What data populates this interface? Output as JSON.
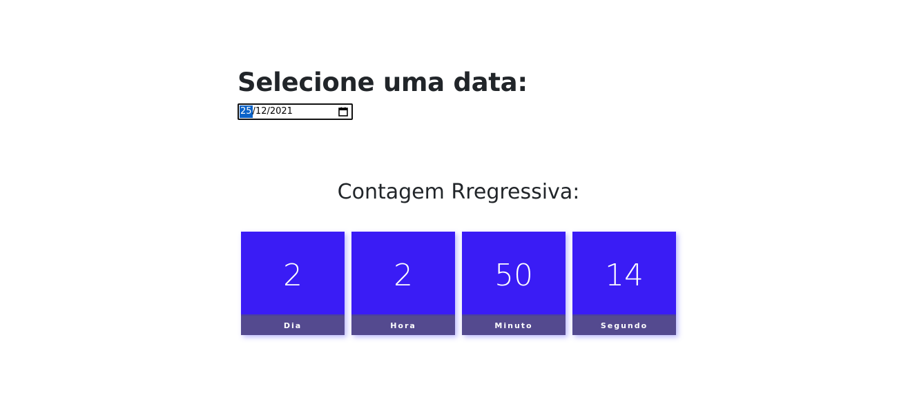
{
  "date_picker": {
    "heading": "Selecione uma data:",
    "day": "25",
    "rest": "/12/2021"
  },
  "countdown": {
    "title": "Contagem Rregressiva:",
    "units": [
      {
        "value": "2",
        "label": "Dia"
      },
      {
        "value": "2",
        "label": "Hora"
      },
      {
        "value": "50",
        "label": "Minuto"
      },
      {
        "value": "14",
        "label": "Segundo"
      }
    ]
  },
  "icons": {
    "calendar": "calendar-icon"
  },
  "colors": {
    "box_value_bg": "#3a1cf5",
    "box_label_bg": "#544a8f",
    "selection": "#0b63c8"
  }
}
